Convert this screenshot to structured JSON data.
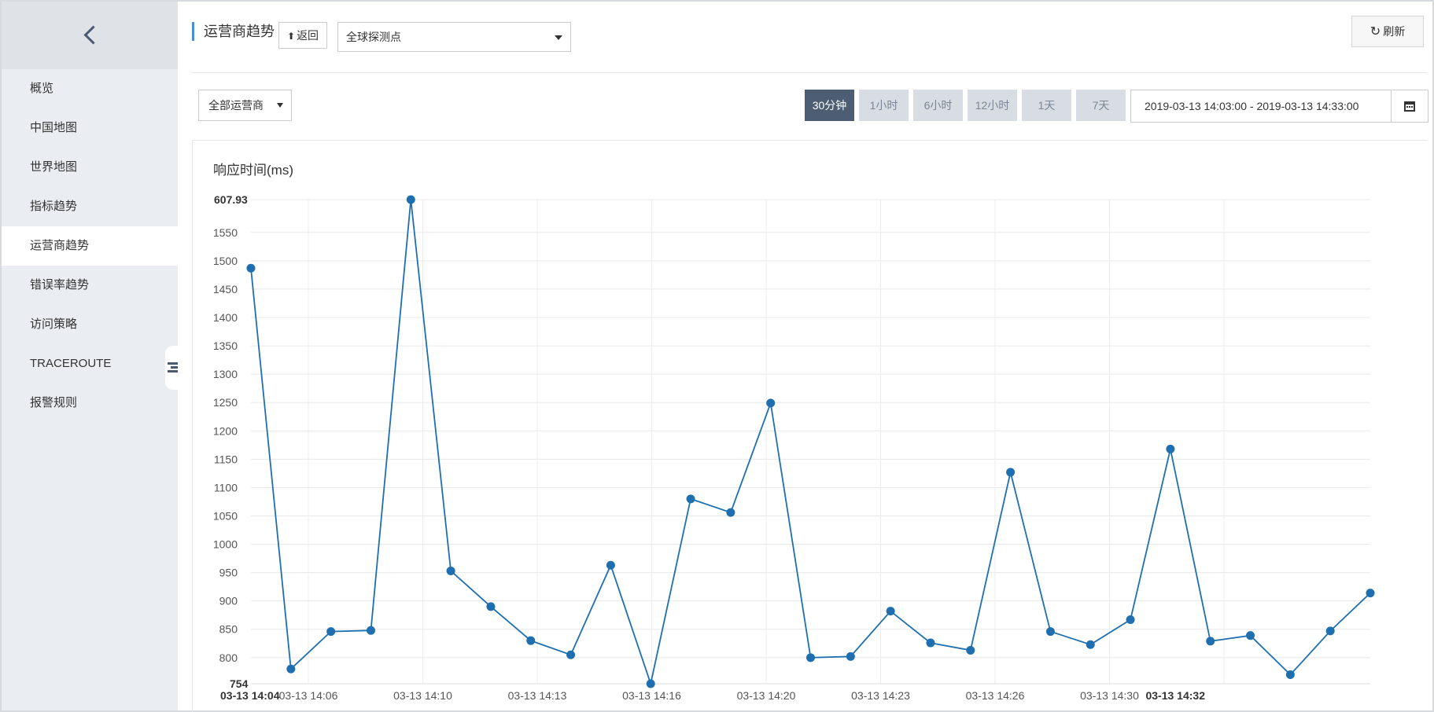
{
  "sidebar": {
    "items": [
      {
        "label": "概览",
        "active": false
      },
      {
        "label": "中国地图",
        "active": false
      },
      {
        "label": "世界地图",
        "active": false
      },
      {
        "label": "指标趋势",
        "active": false
      },
      {
        "label": "运营商趋势",
        "active": true
      },
      {
        "label": "错误率趋势",
        "active": false
      },
      {
        "label": "访问策略",
        "active": false
      },
      {
        "label": "TRACEROUTE",
        "active": false
      },
      {
        "label": "报警规则",
        "active": false
      }
    ]
  },
  "header": {
    "title": "运营商趋势",
    "back_label": "返回",
    "probe_select_value": "全球探测点",
    "refresh_label": "刷新"
  },
  "filters": {
    "carrier_select_value": "全部运营商",
    "ranges": [
      {
        "label": "30分钟",
        "active": true
      },
      {
        "label": "1小时",
        "active": false
      },
      {
        "label": "6小时",
        "active": false
      },
      {
        "label": "12小时",
        "active": false
      },
      {
        "label": "1天",
        "active": false
      },
      {
        "label": "7天",
        "active": false
      }
    ],
    "date_range": "2019-03-13 14:03:00 - 2019-03-13 14:33:00"
  },
  "colors": {
    "series": "#1f6fb0",
    "active_range": "#4d5d73"
  },
  "chart_data": {
    "type": "line",
    "title": "响应时间(ms)",
    "y_min_label": "754",
    "y_max_label": "607.93",
    "ylim": [
      754,
      1607.93
    ],
    "y_ticks": [
      800,
      850,
      900,
      950,
      1000,
      1050,
      1100,
      1150,
      1200,
      1250,
      1300,
      1350,
      1400,
      1450,
      1500,
      1550
    ],
    "x_start_label": "03-13 14:04",
    "x_end_label": "03-13 14:32",
    "x_tick_labels": [
      "03-13 14:06",
      "03-13 14:10",
      "03-13 14:13",
      "03-13 14:16",
      "03-13 14:20",
      "03-13 14:23",
      "03-13 14:26",
      "03-13 14:30"
    ],
    "series": [
      {
        "values": [
          1487,
          780,
          846,
          848,
          1607.93,
          953,
          890,
          830,
          805,
          963,
          754,
          1080,
          1056,
          1249,
          800,
          802,
          882,
          826,
          813,
          1127,
          846,
          823,
          867,
          1168,
          829,
          839,
          770,
          847,
          914
        ]
      }
    ]
  }
}
